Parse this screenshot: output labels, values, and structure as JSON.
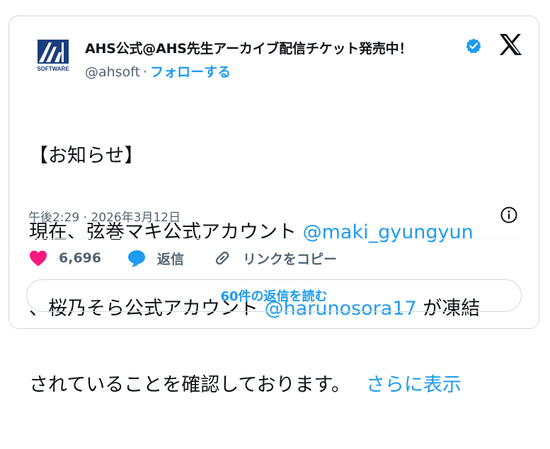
{
  "author": {
    "display_name": "AHS公式@AHS先生アーカイブ配信チケット発売中！",
    "handle": "@ahsoft",
    "separator": "·",
    "follow_label": "フォローする",
    "avatar_text": "SOFTWARE",
    "verified_icon": "verified-badge-icon",
    "platform_icon": "x-logo-icon"
  },
  "tweet": {
    "line1": "【お知らせ】",
    "line2_text": "現在、弦巻マキ公式アカウント ",
    "line2_mention": "@maki_gyungyun",
    "line3_text_a": "、桜乃そら公式アカウント ",
    "line3_mention": "@harunosora17",
    "line3_text_b": " が凍結",
    "line4_text": "されていることを確認しております。",
    "show_more": "さらに表示"
  },
  "timestamp": "午後2:29 · 2026年3月12日",
  "actions": {
    "like_count": "6,696",
    "reply_label": "返信",
    "copy_link_label": "リンクをコピー"
  },
  "read_replies_label": "60件の返信を読む",
  "colors": {
    "accent": "#1d9bf0",
    "like": "#f91880",
    "secondary_text": "#536471",
    "primary_text": "#0f1419",
    "border": "#cfd9de",
    "logo_navy": "#1b3d7d"
  }
}
